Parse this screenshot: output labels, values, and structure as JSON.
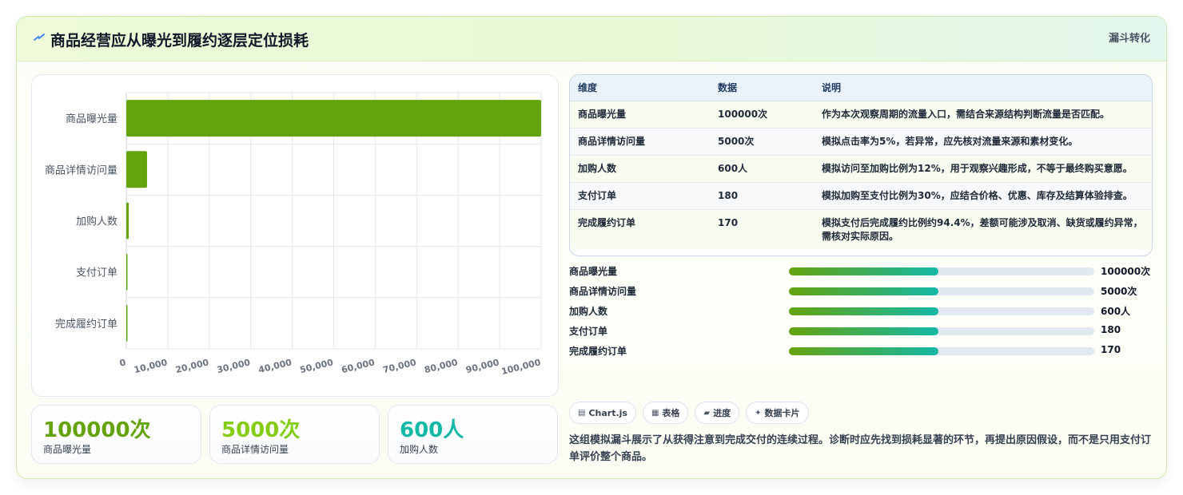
{
  "header": {
    "title": "商品经营应从曝光到履约逐层定位损耗",
    "badge": "漏斗转化",
    "icon": "lightning-icon"
  },
  "colors": {
    "bar": "#65a30d",
    "kpi_1": "#65a30d",
    "kpi_2": "#84cc16",
    "kpi_3": "#14b8a6",
    "progress_start": "#65a30d",
    "progress_end": "#14b8a6"
  },
  "chart_data": {
    "type": "bar",
    "orientation": "horizontal",
    "categories": [
      "商品曝光量",
      "商品详情访问量",
      "加购人数",
      "支付订单",
      "完成履约订单"
    ],
    "values": [
      100000,
      5000,
      600,
      180,
      170
    ],
    "xlim": [
      0,
      100000
    ],
    "x_ticks": [
      "0",
      "10,000",
      "20,000",
      "30,000",
      "40,000",
      "50,000",
      "60,000",
      "70,000",
      "80,000",
      "90,000",
      "100,000"
    ],
    "grid": true
  },
  "kpis": [
    {
      "value": "100000次",
      "label": "商品曝光量"
    },
    {
      "value": "5000次",
      "label": "商品详情访问量"
    },
    {
      "value": "600人",
      "label": "加购人数"
    }
  ],
  "table": {
    "headers": [
      "维度",
      "数据",
      "说明"
    ],
    "rows": [
      {
        "dim": "商品曝光量",
        "value": "100000次",
        "desc": "作为本次观察周期的流量入口，需结合来源结构判断流量是否匹配。"
      },
      {
        "dim": "商品详情访问量",
        "value": "5000次",
        "desc": "模拟点击率为5%，若异常，应先核对流量来源和素材变化。"
      },
      {
        "dim": "加购人数",
        "value": "600人",
        "desc": "模拟访问至加购比例为12%，用于观察兴趣形成，不等于最终购买意愿。"
      },
      {
        "dim": "支付订单",
        "value": "180",
        "desc": "模拟加购至支付比例为30%，应结合价格、优惠、库存及结算体验排查。"
      },
      {
        "dim": "完成履约订单",
        "value": "170",
        "desc": "模拟支付后完成履约比例约94.4%，差额可能涉及取消、缺货或履约异常，需核对实际原因。"
      }
    ]
  },
  "progress": [
    {
      "label": "商品曝光量",
      "value": "100000次",
      "fraction": 0.49
    },
    {
      "label": "商品详情访问量",
      "value": "5000次",
      "fraction": 0.49
    },
    {
      "label": "加购人数",
      "value": "600人",
      "fraction": 0.49
    },
    {
      "label": "支付订单",
      "value": "180",
      "fraction": 0.49
    },
    {
      "label": "完成履约订单",
      "value": "170",
      "fraction": 0.49
    }
  ],
  "chips": [
    {
      "icon": "chart-icon",
      "glyph": "▤",
      "label": "Chart.js"
    },
    {
      "icon": "table-icon",
      "glyph": "▦",
      "label": "表格"
    },
    {
      "icon": "progress-icon",
      "glyph": "▰",
      "label": "进度"
    },
    {
      "icon": "sparkle-icon",
      "glyph": "✦",
      "label": "数据卡片"
    }
  ],
  "summary": "这组模拟漏斗展示了从获得注意到完成交付的连续过程。诊断时应先找到损耗显著的环节，再提出原因假设，而不是只用支付订单评价整个商品。"
}
